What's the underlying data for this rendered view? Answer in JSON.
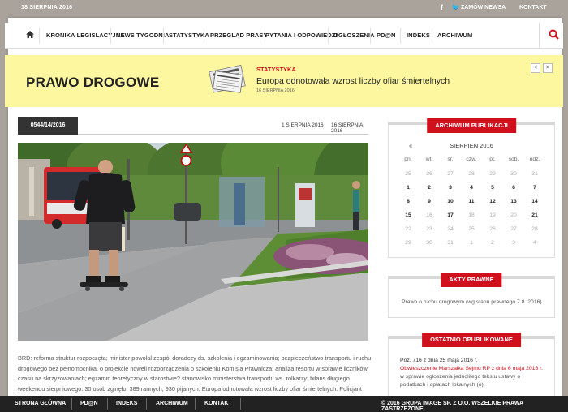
{
  "topbar": {
    "date": "18 SIERPNIA 2016",
    "subscribe": "ZAMÓW NEWSA",
    "contact": "KONTAKT"
  },
  "nav": {
    "items": [
      "KRONIKA LEGISLACYJNA",
      "NEWS TYGODNIA",
      "STATYSTYKA",
      "PRZEGLĄD PRASY",
      "PYTANIA I ODPOWIEDZI",
      "OGŁOSZENIA",
      "PD@N",
      "INDEKS",
      "ARCHIWUM"
    ]
  },
  "banner": {
    "title": "PRAWO DROGOWE",
    "category": "STATYSTYKA",
    "headline": "Europa odnotowała wzrost liczby ofiar śmiertelnych",
    "date": "16 SIERPNIA 2016",
    "prev": "<",
    "next": ">"
  },
  "article": {
    "code": "0544/14/2016",
    "date1": "1 SIERPNIA 2016",
    "date2": "16 SIERPNIA 2016",
    "text": "BRD: reforma struktur rozpoczęta; minister powołał zespół doradczy ds. szkolenia i egzaminowania; bezpieczeństwo transportu i ruchu drogowego bez pełnomocnika, o projekcie noweli rozporządzenia o szkoleniu Komisja Prawnicza; analiza resortu w sprawie liczników czasu na skrzyżowaniach; egzamin teoretyczny w starostwie? stanowisko ministerstwa transportu ws. rolkarzy; bilans długiego weekendu sierpniowego: 30 osób zginęło, 389 rannych, 930 pijanych. Europa odnotowała wzrost liczby ofiar śmiertelnych. Policjant coraz częściej..."
  },
  "archive": {
    "title": "ARCHIWUM PUBLIKACJI",
    "prev": "«",
    "month": "SIERPIEN 2016",
    "days": [
      "pn.",
      "wt.",
      "śr.",
      "czw.",
      "pt.",
      "sob.",
      "ndz."
    ],
    "weeks": [
      [
        "25",
        "26",
        "27",
        "28",
        "29",
        "30",
        "31"
      ],
      [
        "1",
        "2",
        "3",
        "4",
        "5",
        "6",
        "7"
      ],
      [
        "8",
        "9",
        "10",
        "11",
        "12",
        "13",
        "14"
      ],
      [
        "15",
        "16",
        "17",
        "18",
        "19",
        "20",
        "21"
      ],
      [
        "22",
        "23",
        "24",
        "25",
        "26",
        "27",
        "28"
      ],
      [
        "29",
        "30",
        "31",
        "1",
        "2",
        "3",
        "4"
      ]
    ],
    "bold": [
      [
        1,
        0
      ],
      [
        1,
        1
      ],
      [
        1,
        2
      ],
      [
        1,
        3
      ],
      [
        1,
        4
      ],
      [
        1,
        5
      ],
      [
        1,
        6
      ],
      [
        2,
        0
      ],
      [
        2,
        1
      ],
      [
        2,
        2
      ],
      [
        2,
        3
      ],
      [
        2,
        4
      ],
      [
        2,
        5
      ],
      [
        2,
        6
      ],
      [
        3,
        0
      ],
      [
        3,
        2
      ],
      [
        3,
        6
      ]
    ]
  },
  "acts": {
    "title": "AKTY PRAWNE",
    "item": "Prawo o ruchu drogowym (wg stanu prawnego 7.8. 2016)"
  },
  "latest": {
    "title": "OSTATNIO OPUBLIKOWANE",
    "line1": "Poz. 716 z dnia 25 maja 2016 r.",
    "line2": "Obwieszczenie Marszałka Sejmu RP z dnia 6 maja 2016 r.",
    "line3": "w sprawie ogłoszenia jednolitego tekstu ustawy o podatkach i opłatach lokalnych (o)"
  },
  "footer": {
    "items": [
      "STRONA GŁÓWNA",
      "PD@N",
      "INDEKS",
      "ARCHIWUM",
      "KONTAKT"
    ],
    "copy": "© 2016 GRUPA IMAGE SP. Z O.O. WSZELKIE PRAWA ZASTRZEŻONE."
  },
  "colors": {
    "accent": "#d0101d",
    "banner": "#fdf8a0",
    "dark": "#222222"
  },
  "icons": {
    "home": "home-icon",
    "search": "search-icon",
    "facebook": "facebook-icon",
    "twitter": "twitter-icon"
  }
}
